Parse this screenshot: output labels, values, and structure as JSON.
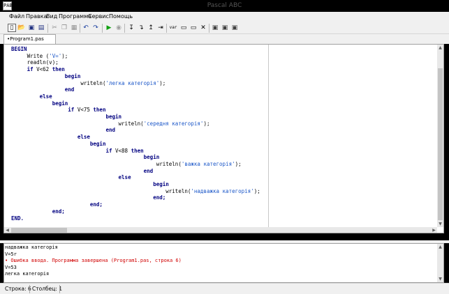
{
  "window": {
    "title": "Pascal ABC",
    "icon_text": "PABC"
  },
  "menu": [
    "Файл",
    "Правка",
    "Вид",
    "Программа",
    "Сервис",
    "Помощь"
  ],
  "toolbar": {
    "buttons": [
      {
        "name": "new-file-icon",
        "glyph": "▯"
      },
      {
        "name": "open-file-icon",
        "glyph": "📂"
      },
      {
        "name": "save-icon",
        "glyph": "▣"
      },
      {
        "name": "save-all-icon",
        "glyph": "▤"
      },
      {
        "name": "cut-icon",
        "glyph": "✂"
      },
      {
        "name": "copy-icon",
        "glyph": "❐"
      },
      {
        "name": "paste-icon",
        "glyph": "▦"
      },
      {
        "name": "undo-icon",
        "glyph": "↶"
      },
      {
        "name": "redo-icon",
        "glyph": "↷"
      },
      {
        "name": "run-icon",
        "glyph": "▶"
      },
      {
        "name": "stop-icon",
        "glyph": "◉"
      },
      {
        "name": "step-over-icon",
        "glyph": "↧"
      },
      {
        "name": "step-into-icon",
        "glyph": "↴"
      },
      {
        "name": "step-out-icon",
        "glyph": "↥"
      },
      {
        "name": "breakpoint-icon",
        "glyph": "⇥"
      },
      {
        "name": "watch-icon",
        "glyph": "▭"
      },
      {
        "name": "window-icon",
        "glyph": "▭"
      },
      {
        "name": "clear-icon",
        "glyph": "✕"
      },
      {
        "name": "form-icon",
        "glyph": "▣"
      },
      {
        "name": "form-designer-icon",
        "glyph": "▣"
      },
      {
        "name": "options-icon",
        "glyph": "▣"
      }
    ],
    "var_label": "var"
  },
  "tab": {
    "label": "•Program1.pas"
  },
  "code": [
    [
      {
        "t": "BEGIN",
        "k": "kw"
      }
    ],
    [
      {
        "t": "     Write ("
      },
      {
        "t": "'V='",
        "k": "str"
      },
      {
        "t": ");"
      }
    ],
    [
      {
        "t": "     readln(v);"
      }
    ],
    [
      {
        "t": "     "
      },
      {
        "t": "if",
        "k": "kw"
      },
      {
        "t": " V<62 "
      },
      {
        "t": "then",
        "k": "kw"
      }
    ],
    [
      {
        "t": "                 "
      },
      {
        "t": "begin",
        "k": "kw"
      }
    ],
    [
      {
        "t": "                      writeln("
      },
      {
        "t": "'легка категорія'",
        "k": "str"
      },
      {
        "t": ");"
      }
    ],
    [
      {
        "t": "                 "
      },
      {
        "t": "end",
        "k": "kw"
      }
    ],
    [
      {
        "t": "         "
      },
      {
        "t": "else",
        "k": "kw"
      }
    ],
    [
      {
        "t": "             "
      },
      {
        "t": "begin",
        "k": "kw"
      }
    ],
    [
      {
        "t": "                  "
      },
      {
        "t": "if",
        "k": "kw"
      },
      {
        "t": " V<75 "
      },
      {
        "t": "then",
        "k": "kw"
      }
    ],
    [
      {
        "t": "                              "
      },
      {
        "t": "begin",
        "k": "kw"
      }
    ],
    [
      {
        "t": "                                  writeln("
      },
      {
        "t": "'середня категорія'",
        "k": "str"
      },
      {
        "t": ");"
      }
    ],
    [
      {
        "t": "                              "
      },
      {
        "t": "end",
        "k": "kw"
      }
    ],
    [
      {
        "t": "                     "
      },
      {
        "t": "else",
        "k": "kw"
      }
    ],
    [
      {
        "t": "                         "
      },
      {
        "t": "begin",
        "k": "kw"
      }
    ],
    [
      {
        "t": "                              "
      },
      {
        "t": "if",
        "k": "kw"
      },
      {
        "t": " V<88 "
      },
      {
        "t": "then",
        "k": "kw"
      }
    ],
    [
      {
        "t": "                                          "
      },
      {
        "t": "begin",
        "k": "kw"
      }
    ],
    [
      {
        "t": "                                              writeln("
      },
      {
        "t": "'важка категорія'",
        "k": "str"
      },
      {
        "t": ");"
      }
    ],
    [
      {
        "t": "                                          "
      },
      {
        "t": "end",
        "k": "kw"
      }
    ],
    [
      {
        "t": "                                  "
      },
      {
        "t": "else",
        "k": "kw"
      }
    ],
    [
      {
        "t": "                                             "
      },
      {
        "t": "begin",
        "k": "kw"
      }
    ],
    [
      {
        "t": "                                                 writeln("
      },
      {
        "t": "'надважка категорія'",
        "k": "str"
      },
      {
        "t": ");"
      }
    ],
    [
      {
        "t": "                                             "
      },
      {
        "t": "end;",
        "k": "kw"
      }
    ],
    [
      {
        "t": "                         "
      },
      {
        "t": "end;",
        "k": "kw"
      }
    ],
    [
      {
        "t": "             "
      },
      {
        "t": "end;",
        "k": "kw"
      }
    ],
    [
      {
        "t": "END.",
        "k": "kw"
      }
    ]
  ],
  "output": [
    {
      "text": "надважка категорія",
      "type": "normal"
    },
    {
      "text": "V=5r",
      "type": "normal"
    },
    {
      "text": "• Ошибка ввода. Программа завершена (Program1.pas, строка 6)",
      "type": "error"
    },
    {
      "text": "V=53",
      "type": "normal"
    },
    {
      "text": "легка категорія",
      "type": "normal"
    }
  ],
  "status": {
    "line": "Строка: 6",
    "column": "Столбец: 1"
  },
  "colors": {
    "keyword": "#000080",
    "string": "#1a56c8",
    "error": "#d00000"
  }
}
